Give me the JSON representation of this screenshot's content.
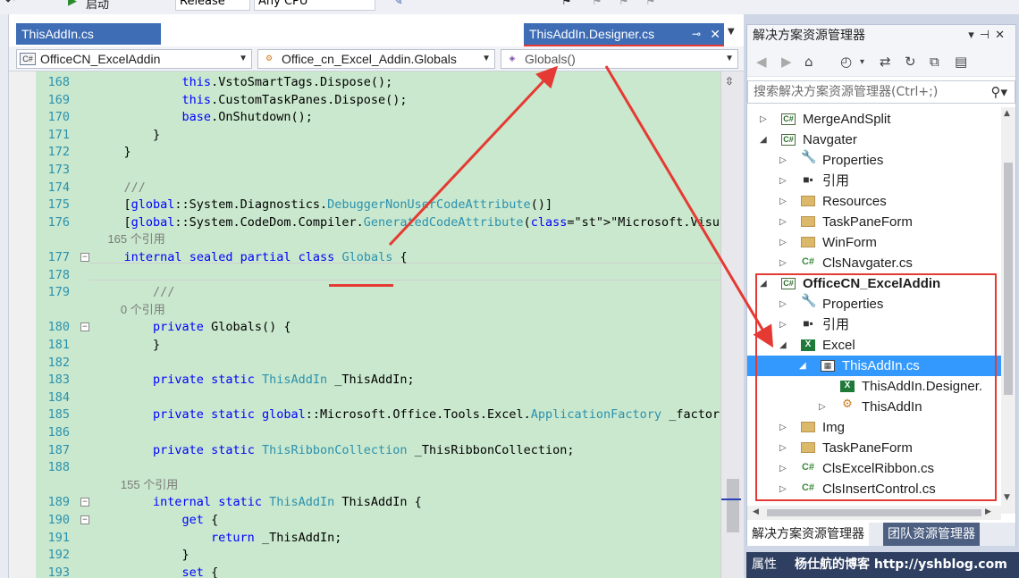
{
  "toolbar": {
    "start_label": "启动",
    "config_value": "Release",
    "platform_value": "Any CPU"
  },
  "editor": {
    "tabs": [
      {
        "label": "ThisAddIn.cs"
      },
      {
        "label": "ThisAddIn.Designer.cs"
      }
    ],
    "nav": {
      "project": "OfficeCN_ExcelAddin",
      "type": "Office_cn_Excel_Addin.Globals",
      "member": "Globals()"
    },
    "lines": [
      {
        "num": "168",
        "text": "            this.VstoSmartTags.Dispose();"
      },
      {
        "num": "169",
        "text": "            this.CustomTaskPanes.Dispose();"
      },
      {
        "num": "170",
        "text": "            base.OnShutdown();"
      },
      {
        "num": "171",
        "text": "        }"
      },
      {
        "num": "172",
        "text": "    }"
      },
      {
        "num": "173",
        "text": ""
      },
      {
        "num": "174",
        "text": "    ///"
      },
      {
        "num": "175",
        "text": "    [global::System.Diagnostics.DebuggerNonUserCodeAttribute()]"
      },
      {
        "num": "176",
        "text": "    [global::System.CodeDom.Compiler.GeneratedCodeAttribute(\"Microsoft.VisualStudio.Tool"
      },
      {
        "num": "",
        "text": "    165 个引用"
      },
      {
        "num": "177",
        "text": "    internal sealed partial class Globals {"
      },
      {
        "num": "178",
        "text": ""
      },
      {
        "num": "179",
        "text": "        ///"
      },
      {
        "num": "",
        "text": "        0 个引用"
      },
      {
        "num": "180",
        "text": "        private Globals() {"
      },
      {
        "num": "181",
        "text": "        }"
      },
      {
        "num": "182",
        "text": ""
      },
      {
        "num": "183",
        "text": "        private static ThisAddIn _ThisAddIn;"
      },
      {
        "num": "184",
        "text": ""
      },
      {
        "num": "185",
        "text": "        private static global::Microsoft.Office.Tools.Excel.ApplicationFactory _factory"
      },
      {
        "num": "186",
        "text": ""
      },
      {
        "num": "187",
        "text": "        private static ThisRibbonCollection _ThisRibbonCollection;"
      },
      {
        "num": "188",
        "text": ""
      },
      {
        "num": "",
        "text": "        155 个引用"
      },
      {
        "num": "189",
        "text": "        internal static ThisAddIn ThisAddIn {"
      },
      {
        "num": "190",
        "text": "            get {"
      },
      {
        "num": "191",
        "text": "                return _ThisAddIn;"
      },
      {
        "num": "192",
        "text": "            }"
      },
      {
        "num": "193",
        "text": "            set {"
      }
    ]
  },
  "solution_explorer": {
    "title": "解决方案资源管理器",
    "search_placeholder": "搜索解决方案资源管理器(Ctrl+;)",
    "items": [
      {
        "label": "MergeAndSplit",
        "icon": "cs-project-icon"
      },
      {
        "label": "Navgater",
        "icon": "cs-project-icon"
      },
      {
        "label": "Properties",
        "icon": "wrench-icon"
      },
      {
        "label": "引用",
        "icon": "references-icon"
      },
      {
        "label": "Resources",
        "icon": "folder-icon"
      },
      {
        "label": "TaskPaneForm",
        "icon": "folder-icon"
      },
      {
        "label": "WinForm",
        "icon": "folder-icon"
      },
      {
        "label": "ClsNavgater.cs",
        "icon": "cs-file-icon"
      },
      {
        "label": "OfficeCN_ExcelAddin",
        "icon": "cs-project-icon"
      },
      {
        "label": "Properties",
        "icon": "wrench-icon"
      },
      {
        "label": "引用",
        "icon": "references-icon"
      },
      {
        "label": "Excel",
        "icon": "excel-icon"
      },
      {
        "label": "ThisAddIn.cs",
        "icon": "designer-file-icon"
      },
      {
        "label": "ThisAddIn.Designer.",
        "icon": "excel-icon"
      },
      {
        "label": "ThisAddIn",
        "icon": "class-icon"
      },
      {
        "label": "Img",
        "icon": "folder-icon"
      },
      {
        "label": "TaskPaneForm",
        "icon": "folder-icon"
      },
      {
        "label": "ClsExcelRibbon.cs",
        "icon": "cs-file-icon"
      },
      {
        "label": "ClsInsertControl.cs",
        "icon": "cs-file-icon"
      }
    ],
    "bottom_tabs": [
      "解决方案资源管理器",
      "团队资源管理器"
    ]
  },
  "status": {
    "properties_label": "属性",
    "blog_text": "杨仕航的博客 http://yshblog.com"
  },
  "colors": {
    "annotation_red": "#e53a33",
    "selection_blue": "#3399ff",
    "code_background": "#c9e8cd"
  }
}
